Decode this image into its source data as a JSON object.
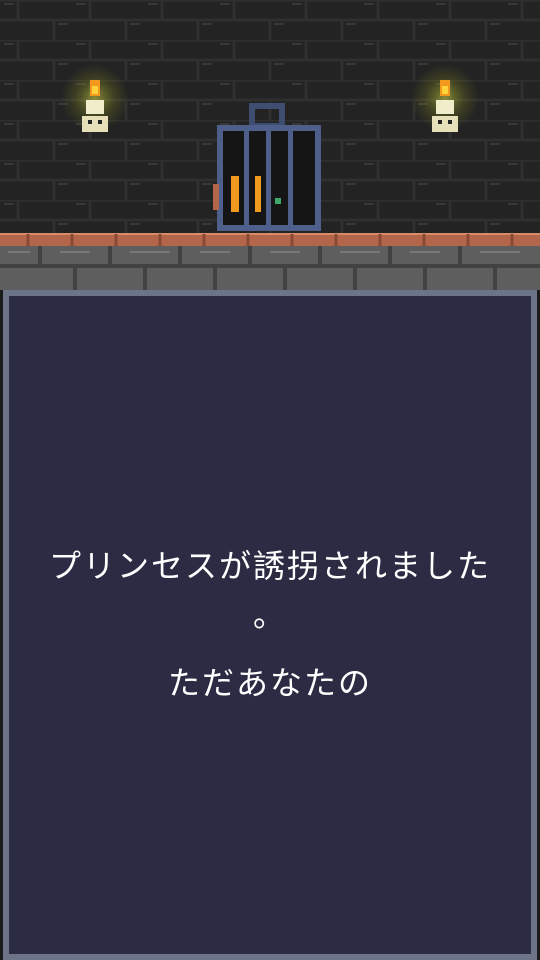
{
  "scene": {
    "icons": [
      "torch-icon",
      "cage-icon",
      "skull-icon"
    ],
    "colors": {
      "wall": "#232323",
      "brick_line": "#303030",
      "ledge": "#b3664a",
      "floor": "#5e5e5e",
      "flame": "#f29a1f",
      "cage": "#4d5f8a"
    }
  },
  "dialog": {
    "lines": [
      "プリンセスが誘拐されました",
      "。",
      "ただあなたの"
    ],
    "colors": {
      "background": "#2b2b43",
      "border": "#6d7487",
      "text": "#ffffff"
    }
  }
}
